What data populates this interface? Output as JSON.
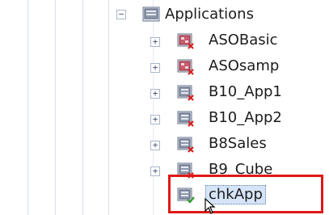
{
  "tree": {
    "root": {
      "label": "Applications",
      "expander": "−",
      "icon": "application-folder-icon"
    },
    "children": [
      {
        "label": "ASOBasic",
        "expander": "+",
        "icon": "aso-cube-stopped-icon"
      },
      {
        "label": "ASOsamp",
        "expander": "+",
        "icon": "aso-cube-stopped-icon"
      },
      {
        "label": "B10_App1",
        "expander": "+",
        "icon": "app-stopped-icon"
      },
      {
        "label": "B10_App2",
        "expander": "+",
        "icon": "app-stopped-icon"
      },
      {
        "label": "B8Sales",
        "expander": "+",
        "icon": "app-stopped-icon"
      },
      {
        "label": "B9_Cube",
        "expander": "+",
        "icon": "app-stopped-icon"
      },
      {
        "label": "chkApp",
        "expander": "",
        "icon": "app-running-icon",
        "selected": true
      }
    ]
  },
  "colors": {
    "guide_lines": "#d9def5",
    "highlight": "#e01818",
    "selection": "#d6e4f7",
    "stopped_mark": "#d42020",
    "running_mark": "#2e9a2e"
  }
}
